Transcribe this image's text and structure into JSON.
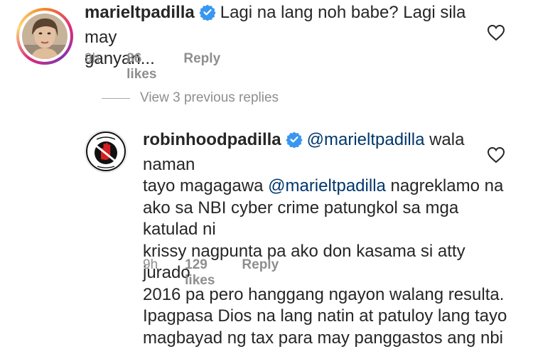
{
  "comments": [
    {
      "username": "marieltpadilla",
      "verified": true,
      "text": "Lagi na lang noh babe? Lagi sila may ganyan...",
      "line1": "Lagi na lang noh babe? Lagi sila may",
      "line2": "ganyan...",
      "time": "9h",
      "likes": "86 likes",
      "reply_label": "Reply",
      "avatar_icon": "profile-photo-woman"
    },
    {
      "username": "robinhoodpadilla",
      "verified": true,
      "mention1": "@marieltpadilla",
      "line1_rest": " wala naman",
      "line2_pre": "tayo magagawa ",
      "mention2": "@marieltpadilla",
      "line2_post": " nagreklamo na",
      "line3": "ako sa NBI cyber crime patungkol sa mga katulad ni",
      "line4": "krissy nagpunta pa ako don kasama si atty jurado",
      "line5": "2016 pa pero hanggang ngayon walang resulta.",
      "line6": "Ipagpasa Dios na lang natin at patuloy lang tayo",
      "line7": "magbayad ng tax para may panggastos ang nbi",
      "time": "9h",
      "likes": "129 likes",
      "reply_label": "Reply",
      "avatar_icon": "red-hand-logo"
    }
  ],
  "view_replies_label": "View 3 previous replies",
  "colors": {
    "text": "#262626",
    "muted": "#8e8e8e",
    "mention": "#00376b",
    "verified": "#3897f0"
  }
}
